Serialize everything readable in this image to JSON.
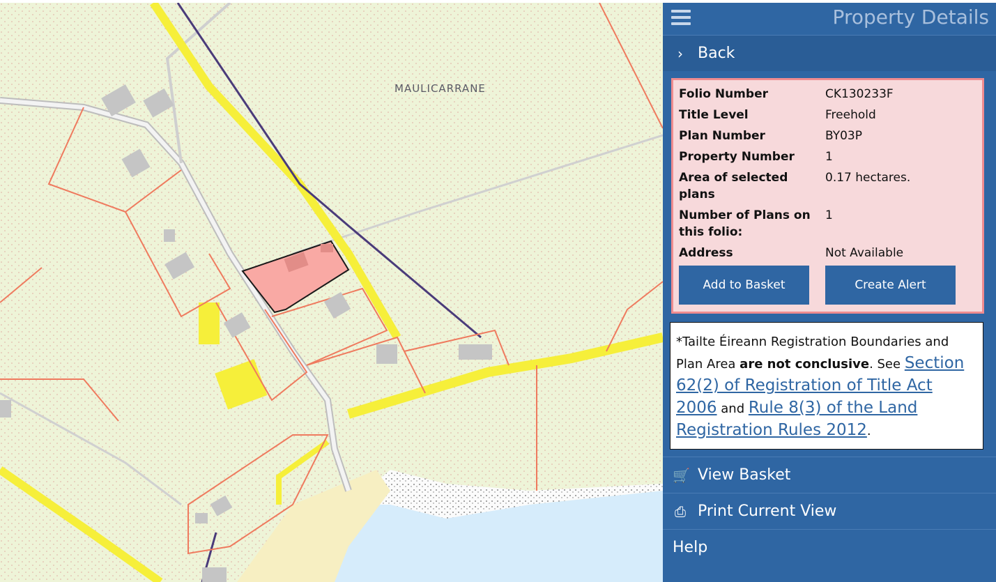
{
  "map": {
    "place_label": "MAULICARRANE"
  },
  "panel": {
    "title": "Property Details",
    "back_label": "Back",
    "details": {
      "rows": [
        {
          "label": "Folio Number",
          "value": "CK130233F"
        },
        {
          "label": "Title Level",
          "value": "Freehold"
        },
        {
          "label": "Plan Number",
          "value": "BY03P"
        },
        {
          "label": "Property Number",
          "value": "1"
        },
        {
          "label": "Area of selected plans",
          "value": "0.17 hectares."
        },
        {
          "label": "Number of Plans on this folio:",
          "value": "1"
        },
        {
          "label": "Address",
          "value": "Not Available"
        }
      ],
      "add_basket_label": "Add to Basket",
      "create_alert_label": "Create Alert"
    },
    "note": {
      "prefix": "*Tailte Éireann Registration Boundaries and Plan Area ",
      "bold": "are not conclusive",
      "middle": ". See ",
      "link1": "Section 62(2) of Registration of Title Act 2006",
      "and": " and ",
      "link2": "Rule 8(3) of the Land Registration Rules 2012",
      "suffix": "."
    },
    "menu": {
      "view_basket": "View Basket",
      "print_view": "Print Current View",
      "help": "Help"
    }
  },
  "colors": {
    "panel_bg": "#2f66a3",
    "selected_parcel": "#f9a9a4",
    "boundary": "#ef7a5e",
    "road_yellow": "#f6ef3a",
    "sea": "#d6ecfb"
  }
}
